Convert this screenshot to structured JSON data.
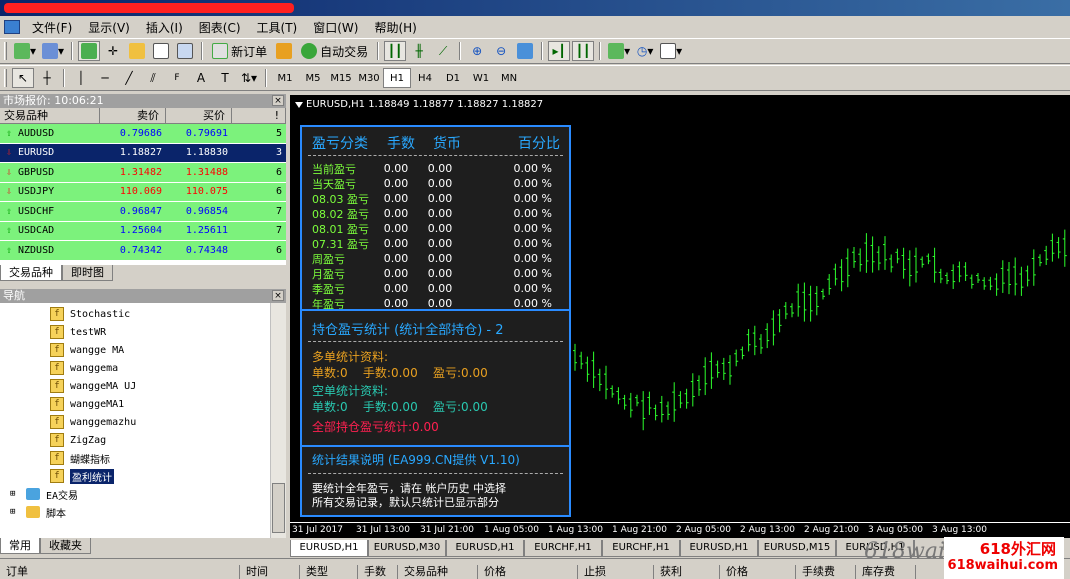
{
  "menu": [
    "文件(F)",
    "显示(V)",
    "插入(I)",
    "图表(C)",
    "工具(T)",
    "窗口(W)",
    "帮助(H)"
  ],
  "toolbar": {
    "new_order": "新订单",
    "auto_trade": "自动交易"
  },
  "timeframes": [
    "M1",
    "M5",
    "M15",
    "M30",
    "H1",
    "H4",
    "D1",
    "W1",
    "MN"
  ],
  "active_timeframe": "H1",
  "market_watch": {
    "title": "市场报价: 10:06:21",
    "columns": [
      "交易品种",
      "卖价",
      "买价",
      "!"
    ],
    "rows": [
      {
        "symbol": "AUDUSD",
        "bid": "0.79686",
        "ask": "0.79691",
        "spread": "5",
        "dir": "up",
        "bg": "#7cf27c",
        "color": "#0000ff"
      },
      {
        "symbol": "EURUSD",
        "bid": "1.18827",
        "ask": "1.18830",
        "spread": "3",
        "dir": "down",
        "bg": "#0a246a",
        "color": "#ffffff"
      },
      {
        "symbol": "GBPUSD",
        "bid": "1.31482",
        "ask": "1.31488",
        "spread": "6",
        "dir": "down",
        "bg": "#7cf27c",
        "color": "#ff0000"
      },
      {
        "symbol": "USDJPY",
        "bid": "110.069",
        "ask": "110.075",
        "spread": "6",
        "dir": "down",
        "bg": "#7cf27c",
        "color": "#ff0000"
      },
      {
        "symbol": "USDCHF",
        "bid": "0.96847",
        "ask": "0.96854",
        "spread": "7",
        "dir": "up",
        "bg": "#7cf27c",
        "color": "#0000ff"
      },
      {
        "symbol": "USDCAD",
        "bid": "1.25604",
        "ask": "1.25611",
        "spread": "7",
        "dir": "up",
        "bg": "#7cf27c",
        "color": "#0000ff"
      },
      {
        "symbol": "NZDUSD",
        "bid": "0.74342",
        "ask": "0.74348",
        "spread": "6",
        "dir": "up",
        "bg": "#7cf27c",
        "color": "#0000ff"
      }
    ],
    "tabs": [
      "交易品种",
      "即时图"
    ]
  },
  "navigator": {
    "title": "导航",
    "items": [
      "Stochastic",
      "testWR",
      "wangge MA",
      "wanggema",
      "wanggeMA UJ",
      "wanggeMA1",
      "wanggemazhu",
      "ZigZag",
      "蝴蝶指标",
      "盈利统计"
    ],
    "selected": "盈利统计",
    "folders": [
      "EA交易",
      "脚本"
    ],
    "tabs": [
      "常用",
      "收藏夹"
    ]
  },
  "chart": {
    "title": "EURUSD,H1  1.18849 1.18877 1.18827 1.18827",
    "x_labels": [
      "31 Jul 2017",
      "31 Jul 13:00",
      "31 Jul 21:00",
      "1 Aug 05:00",
      "1 Aug 13:00",
      "1 Aug 21:00",
      "2 Aug 05:00",
      "2 Aug 13:00",
      "2 Aug 21:00",
      "3 Aug 05:00",
      "3 Aug 13:00"
    ],
    "tabs": [
      "EURUSD,H1",
      "EURUSD,M30",
      "EURUSD,H1",
      "EURCHF,H1",
      "EURCHF,H1",
      "EURUSD,H1",
      "EURUSD,M15",
      "EURUSD,H1",
      "EUR"
    ]
  },
  "info_panel": {
    "header": [
      "盈亏分类",
      "手数",
      "货币",
      "百分比"
    ],
    "stats": [
      {
        "name": "当前盈亏",
        "lots": "0.00",
        "money": "0.00",
        "pct": "0.00 %"
      },
      {
        "name": "当天盈亏",
        "lots": "0.00",
        "money": "0.00",
        "pct": "0.00 %"
      },
      {
        "name": "08.03 盈亏",
        "lots": "0.00",
        "money": "0.00",
        "pct": "0.00 %"
      },
      {
        "name": "08.02 盈亏",
        "lots": "0.00",
        "money": "0.00",
        "pct": "0.00 %"
      },
      {
        "name": "08.01 盈亏",
        "lots": "0.00",
        "money": "0.00",
        "pct": "0.00 %"
      },
      {
        "name": "07.31 盈亏",
        "lots": "0.00",
        "money": "0.00",
        "pct": "0.00 %"
      },
      {
        "name": "周盈亏",
        "lots": "0.00",
        "money": "0.00",
        "pct": "0.00 %"
      },
      {
        "name": "月盈亏",
        "lots": "0.00",
        "money": "0.00",
        "pct": "0.00 %"
      },
      {
        "name": "季盈亏",
        "lots": "0.00",
        "money": "0.00",
        "pct": "0.00 %"
      },
      {
        "name": "年盈亏",
        "lots": "0.00",
        "money": "0.00",
        "pct": "0.00 %"
      }
    ],
    "position_title": "持仓盈亏统计 (统计全部持仓) - 2",
    "long_title": "多单统计资料:",
    "long_line": "单数:0    手数:0.00    盈亏:0.00",
    "short_title": "空单统计资料:",
    "short_line": "单数:0    手数:0.00    盈亏:0.00",
    "total_line": "全部持仓盈亏统计:0.00",
    "explain_title": "统计结果说明 (EA999.CN提供 V1.10)",
    "explain_1": "要统计全年盈亏，请在 帐户历史 中选择",
    "explain_2": "所有交易记录，默认只统计已显示部分"
  },
  "terminal_columns": [
    "订单",
    "时间",
    "类型",
    "手数",
    "交易品种",
    "价格",
    "止损",
    "获利",
    "价格",
    "手续费",
    "库存费"
  ],
  "watermark": {
    "site": "618外汇网",
    "url": "618waihui.com",
    "grey": "618wai"
  }
}
